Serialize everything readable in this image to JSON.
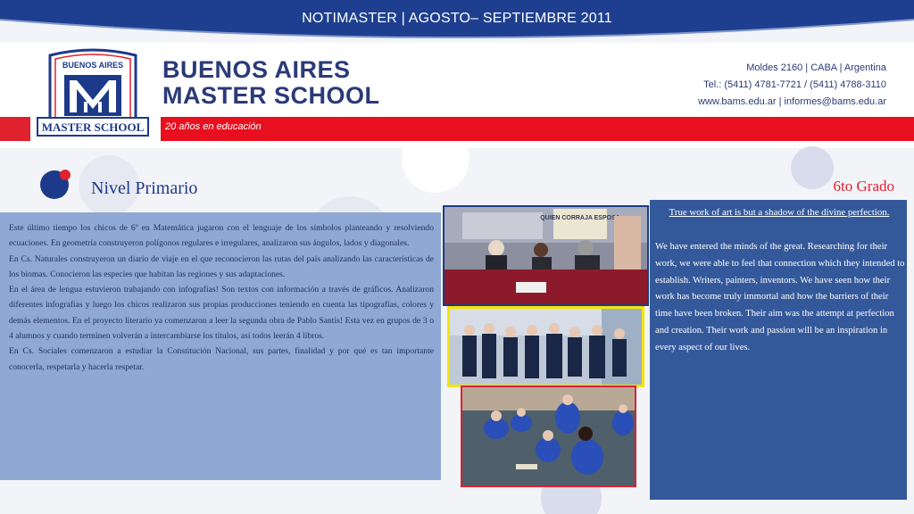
{
  "header": {
    "banner_title": "NOTIMASTER | AGOSTO– SEPTIEMBRE 2011",
    "school_name_line1": "BUENOS AIRES",
    "school_name_line2": "MASTER SCHOOL",
    "tagline": "20 años en educación",
    "contact": [
      "Moldes 2160 | CABA | Argentina",
      "Tel.: (5411) 4781-7721 / (5411) 4788-3110",
      "www.bams.edu.ar | informes@bams.edu.ar"
    ],
    "logo": {
      "top_text": "BUENOS AIRES",
      "bottom_text": "MASTER SCHOOL"
    }
  },
  "section": {
    "title": "Nivel Primario",
    "grade": "6to Grado"
  },
  "left_paragraphs": [
    "Este último tiempo los chicos de 6º en Matemática jugaron con el lenguaje de los símbolos planteando y resolviendo ecuaciones. En geometría construyeron polígonos regulares e irregulares, analizaron sus ángulos, lados y diagonales.",
    "En Cs. Naturales construyeron un diario de viaje en el que reconocieron las rutas del país analizando las características de los biomas. Conocieron las especies que habitan las regiones y sus adaptaciones.",
    "En el área de lengua estuvieron trabajando con infografías! Son textos con información a través de gráficos. Analizaron diferentes infografías y luego los chicos realizaron sus propias producciones teniendo en cuenta las tipografías, colores y demás elementos. En el proyecto literario ya comenzaron a leer la segunda obra de Pablo Santis! Esta vez  en grupos de 3 o 4 alumnos y cuando terminen volverán a intercambiarse los títulos, así todos leerán 4 libros.",
    "En Cs. Sociales comenzaron a estudiar la Constitución Nacional, sus partes, finalidad y por qué es tan importante conocerla, respetarla y hacerla respetar."
  ],
  "right_panel": {
    "quote": "True work of art is but a shadow of the divine perfection.",
    "body": "We have entered the minds of the great. Researching for their work, we were able to feel that connection which they intended to establish. Writers, painters, inventors. We have seen how their work has become truly immortal and how the barriers of their time have been broken. Their aim was the attempt at perfection and creation. Their work and passion will be an inspiration in every aspect of our lives."
  },
  "photo_sign_text": "QUIEN CORRAJA ESPOSA",
  "colors": {
    "navy": "#1d3a8a",
    "red": "#e8101f",
    "panel_blue": "#34599b",
    "light_panel": "#8fa9d4"
  }
}
